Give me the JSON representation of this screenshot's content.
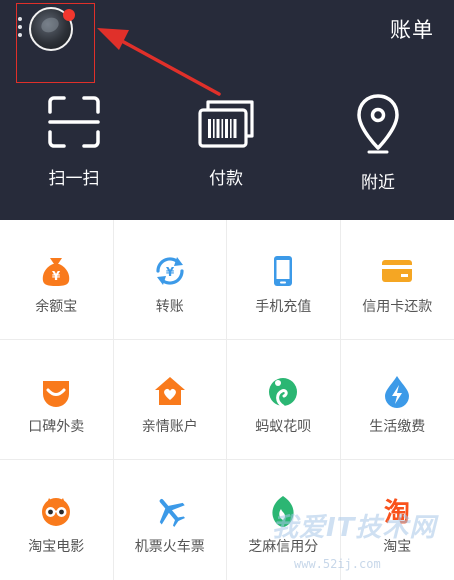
{
  "header": {
    "bill_label": "账单",
    "actions": [
      {
        "label": "扫一扫"
      },
      {
        "label": "付款"
      },
      {
        "label": "附近"
      }
    ]
  },
  "grid": {
    "rows": [
      [
        {
          "label": "余额宝",
          "icon": "money-bag-icon",
          "color": "#f97a1c"
        },
        {
          "label": "转账",
          "icon": "transfer-icon",
          "color": "#3c9ae8"
        },
        {
          "label": "手机充值",
          "icon": "phone-icon",
          "color": "#3c9ae8"
        },
        {
          "label": "信用卡还款",
          "icon": "credit-card-icon",
          "color": "#f5a623"
        }
      ],
      [
        {
          "label": "口碑外卖",
          "icon": "smile-bag-icon",
          "color": "#f97a1c"
        },
        {
          "label": "亲情账户",
          "icon": "house-heart-icon",
          "color": "#f97a1c"
        },
        {
          "label": "蚂蚁花呗",
          "icon": "huabei-icon",
          "color": "#2bb673"
        },
        {
          "label": "生活缴费",
          "icon": "lightning-drop-icon",
          "color": "#3c9ae8"
        }
      ],
      [
        {
          "label": "淘宝电影",
          "icon": "glasses-face-icon",
          "color": "#f97a1c"
        },
        {
          "label": "机票火车票",
          "icon": "airplane-icon",
          "color": "#3c9ae8"
        },
        {
          "label": "芝麻信用分",
          "icon": "sesame-seed-icon",
          "color": "#2bb673"
        },
        {
          "label": "淘宝",
          "icon": "taobao-logo-icon",
          "color": "#f9521c"
        }
      ]
    ]
  },
  "watermark": {
    "text": "我爱IT技术网",
    "url": "www.52ij.com"
  }
}
